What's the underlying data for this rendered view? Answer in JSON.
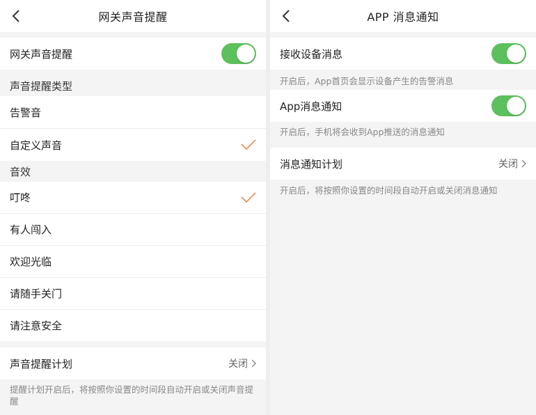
{
  "left": {
    "title": "网关声音提醒",
    "master_toggle": {
      "label": "网关声音提醒",
      "on": true
    },
    "sound_type_header": "声音提醒类型",
    "sound_types": [
      {
        "label": "告警音",
        "selected": false
      },
      {
        "label": "自定义声音",
        "selected": true
      }
    ],
    "effects_header": "音效",
    "effects": [
      {
        "label": "叮咚",
        "selected": true
      },
      {
        "label": "有人闯入",
        "selected": false
      },
      {
        "label": "欢迎光临",
        "selected": false
      },
      {
        "label": "请随手关门",
        "selected": false
      },
      {
        "label": "请注意安全",
        "selected": false
      }
    ],
    "schedule": {
      "label": "声音提醒计划",
      "value": "关闭"
    },
    "schedule_note": "提醒计划开启后，将按照你设置的时间段自动开启或关闭声音提醒"
  },
  "right": {
    "title": "APP 消息通知",
    "device_msg": {
      "label": "接收设备消息",
      "on": true
    },
    "device_msg_note": "开启后，App首页会显示设备产生的告警消息",
    "app_notify": {
      "label": "App消息通知",
      "on": true
    },
    "app_notify_note": "开启后，手机将会收到App推送的消息通知",
    "schedule": {
      "label": "消息通知计划",
      "value": "关闭"
    },
    "schedule_note": "开启后，将按照你设置的时间段自动开启或关闭消息通知"
  },
  "colors": {
    "toggle_on": "#5cc05c",
    "checkmark": "#e8935c"
  },
  "icons": {
    "back": "chevron-left-icon",
    "check": "checkmark-icon",
    "chevron": "chevron-right-icon"
  }
}
